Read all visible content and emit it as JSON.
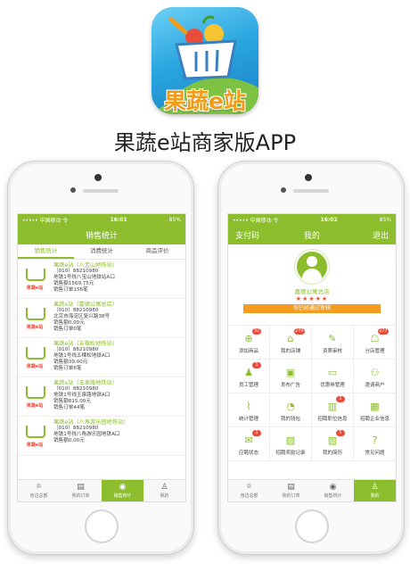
{
  "logo": {
    "text": "果蔬e站"
  },
  "app_title": "果蔬e站商家版APP",
  "colors": {
    "accent": "#8bbd2c",
    "orange": "#f39c1f",
    "badge": "#e74c3c",
    "logo_blue": "#2aa6e0"
  },
  "left": {
    "status": {
      "carrier": "••••• 中国移动 令",
      "time": "16:01",
      "battery": "85%"
    },
    "header_title": "销售统计",
    "tabs": [
      {
        "label": "销售统计",
        "active": true
      },
      {
        "label": "消费统计",
        "active": false
      },
      {
        "label": "商品评价",
        "active": false
      }
    ],
    "thumb_text": "果蔬e站",
    "stores": [
      {
        "name": "果蔬e站（八宝山地铁站）",
        "phone": "（010）88210980",
        "addr": "地铁1号线八宝山地铁站A口",
        "sales": "销售额1569.75元",
        "orders": "销售订单156笔"
      },
      {
        "name": "果蔬e站（嘉德公寓总店）",
        "phone": "（010）88210980",
        "addr": "北京市海淀区复兴路38号",
        "sales": "销售额0.00元",
        "orders": "销售订单0笔"
      },
      {
        "name": "果蔬e站（五棵松地铁站）",
        "phone": "（010）88210980",
        "addr": "地铁1号线五棵松地铁A口",
        "sales": "销售额39.00元",
        "orders": "销售订单6笔"
      },
      {
        "name": "果蔬e站（玉泉路地铁站）",
        "phone": "（010）88210980",
        "addr": "地铁1号线玉泉路地铁A口",
        "sales": "销售额815.00元",
        "orders": "销售订单44笔"
      },
      {
        "name": "果蔬e站（八角游乐园地铁站）",
        "phone": "（010）88210980",
        "addr": "地铁1号线八角游乐园地铁A口",
        "sales": "销售额0.00元",
        "orders": ""
      }
    ],
    "nav": [
      {
        "label": "身边总部",
        "icon": "location-icon",
        "glyph": "⌾",
        "active": false
      },
      {
        "label": "我的订单",
        "icon": "orders-icon",
        "glyph": "▤",
        "active": false
      },
      {
        "label": "销售统计",
        "icon": "stats-icon",
        "glyph": "◉",
        "active": true
      },
      {
        "label": "我的",
        "icon": "user-icon",
        "glyph": "♙",
        "active": false
      }
    ]
  },
  "right": {
    "status": {
      "carrier": "••••• 中国移动 令",
      "time": "16:02",
      "battery": "85%"
    },
    "header_left": "支付码",
    "header_title": "我的",
    "header_right": "退出",
    "shop_name": "嘉德公寓总店",
    "stars": "★★★★★",
    "audit_text": "你已经通过审核",
    "grid": [
      {
        "label": "添加商品",
        "icon": "add-product-icon",
        "glyph": "⊕",
        "badge": "32"
      },
      {
        "label": "我的店铺",
        "icon": "shop-icon",
        "glyph": "⌂",
        "badge": "270"
      },
      {
        "label": "资质审核",
        "icon": "certificate-icon",
        "glyph": "✎",
        "badge": ""
      },
      {
        "label": "分店管理",
        "icon": "branch-icon",
        "glyph": "☖",
        "badge": "277"
      },
      {
        "label": "员工管理",
        "icon": "staff-icon",
        "glyph": "♟",
        "badge": "1"
      },
      {
        "label": "发布广告",
        "icon": "ad-icon",
        "glyph": "▣",
        "badge": ""
      },
      {
        "label": "优惠券管理",
        "icon": "coupon-icon",
        "glyph": "▭",
        "badge": ""
      },
      {
        "label": "邀请商户",
        "icon": "invite-icon",
        "glyph": "⚇",
        "badge": ""
      },
      {
        "label": "统计管理",
        "icon": "chart-icon",
        "glyph": "⌇",
        "badge": ""
      },
      {
        "label": "我的钱包",
        "icon": "wallet-icon",
        "glyph": "◔",
        "badge": ""
      },
      {
        "label": "招聘职位信息",
        "icon": "job-icon",
        "glyph": "▥",
        "badge": "1"
      },
      {
        "label": "招聘企业信息",
        "icon": "company-icon",
        "glyph": "▦",
        "badge": ""
      },
      {
        "label": "应聘状态",
        "icon": "apply-icon",
        "glyph": "✉",
        "badge": "1"
      },
      {
        "label": "招聘奖励记录",
        "icon": "reward-icon",
        "glyph": "▨",
        "badge": ""
      },
      {
        "label": "我的简历",
        "icon": "resume-icon",
        "glyph": "▧",
        "badge": "5"
      },
      {
        "label": "常见问题",
        "icon": "question-icon",
        "glyph": "?",
        "badge": ""
      }
    ],
    "nav": [
      {
        "label": "身边总部",
        "icon": "location-icon",
        "glyph": "⌾",
        "active": false
      },
      {
        "label": "我的订单",
        "icon": "orders-icon",
        "glyph": "▤",
        "active": false
      },
      {
        "label": "销售统计",
        "icon": "stats-icon",
        "glyph": "◉",
        "active": false
      },
      {
        "label": "我的",
        "icon": "user-icon",
        "glyph": "♙",
        "active": true
      }
    ]
  }
}
